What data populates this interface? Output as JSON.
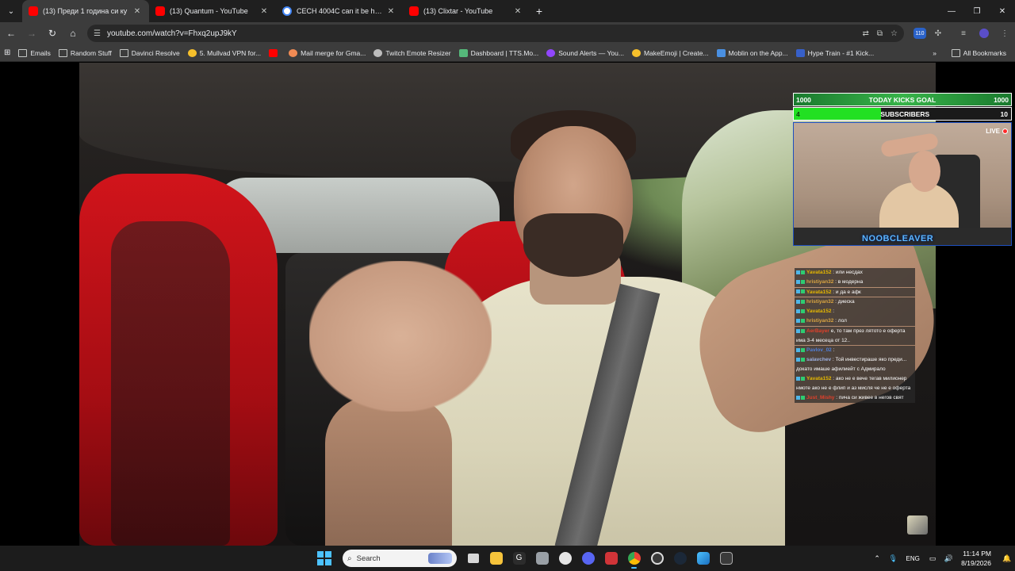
{
  "browser": {
    "tabs": [
      {
        "title": "(13) Преди 1 година си ку",
        "favicon": "youtube-icon",
        "active": true
      },
      {
        "title": "(13) Quantum - YouTube",
        "favicon": "youtube-icon",
        "active": false
      },
      {
        "title": "CECH 4004C can it be hacked -",
        "favicon": "google-icon",
        "active": false
      },
      {
        "title": "(13) Clixtar - YouTube",
        "favicon": "youtube-icon",
        "active": false
      }
    ],
    "url": "youtube.com/watch?v=Fhxq2upJ9kY",
    "extension_badge": "110",
    "bookmarks": [
      {
        "label": "Emails",
        "icon": "folder"
      },
      {
        "label": "Random Stuff",
        "icon": "folder"
      },
      {
        "label": "Davinci Resolve",
        "icon": "folder"
      },
      {
        "label": "5. Mullvad VPN for...",
        "icon": "yellow"
      },
      {
        "label": "",
        "icon": "red"
      },
      {
        "label": "Mail merge for Gma...",
        "icon": "orange"
      },
      {
        "label": "Twitch Emote Resizer",
        "icon": "gray"
      },
      {
        "label": "Dashboard | TTS.Mo...",
        "icon": "green"
      },
      {
        "label": "Sound Alerts — You...",
        "icon": "purple"
      },
      {
        "label": "MakeEmoji | Create...",
        "icon": "yellow"
      },
      {
        "label": "Moblin on the App...",
        "icon": "blue"
      },
      {
        "label": "Hype Train - #1 Kick...",
        "icon": "navy"
      }
    ],
    "all_bookmarks": "All Bookmarks"
  },
  "overlay": {
    "kicks_goal": {
      "left": "1000",
      "label": "TODAY KICKS GOAL",
      "right": "1000"
    },
    "subscribers": {
      "left": "4",
      "label": "SUBSCRIBERS",
      "right": "10",
      "progress": 0.4
    },
    "live_label": "LIVE",
    "streamer_name": "NOOBCLEAVER",
    "chat": [
      {
        "user": "Yavata152",
        "color": "#e6b800",
        "text": ": или несдах"
      },
      {
        "user": "hristiyan32",
        "color": "#d9a441",
        "text": ": в модерна"
      },
      {
        "user": "Yavata152",
        "color": "#e6b800",
        "text": ": и да е афк"
      },
      {
        "user": "hristiyan32",
        "color": "#d9a441",
        "text": ": диеска"
      },
      {
        "user": "Yavata152",
        "color": "#e6b800",
        "text": ":"
      },
      {
        "user": "hristiyan32",
        "color": "#d9a441",
        "text": ": лол"
      },
      {
        "user": "AerBayer",
        "color": "#e0402a",
        "text": "е, то там през лятото е оферта има 3-4 месеца от 12.."
      },
      {
        "user": "Pavlov_02",
        "color": "#4f7fd9",
        "text": ":"
      },
      {
        "user": "salavchev",
        "color": "#9db0e0",
        "text": ": Той инвестираше яко преди... докато имаше афилиейт с Адмирало"
      },
      {
        "user": "Yavata152",
        "color": "#e6b800",
        "text": ": ако не е вече тегав милионер нмоте ако не е флип и аз мисля че не е оферта"
      },
      {
        "user": "Just_Mishy",
        "color": "#e0402a",
        "text": ": пича си живее в негов свят"
      }
    ]
  },
  "taskbar": {
    "search_placeholder": "Search",
    "language": "ENG",
    "time": "11:14 PM",
    "date": "8/19/2026"
  }
}
